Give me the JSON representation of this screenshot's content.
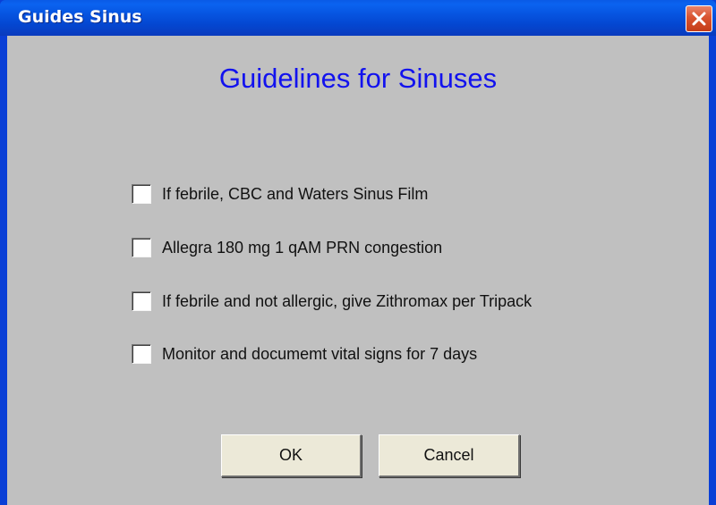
{
  "window": {
    "title": "Guides Sinus",
    "heading": "Guidelines for Sinuses"
  },
  "options": [
    {
      "label": "If febrile, CBC and Waters Sinus Film",
      "checked": false
    },
    {
      "label": "Allegra 180 mg 1 qAM PRN congestion",
      "checked": false
    },
    {
      "label": "If febrile and not allergic, give Zithromax per Tripack",
      "checked": false
    },
    {
      "label": "Monitor and documemt vital signs for 7 days",
      "checked": false
    }
  ],
  "buttons": {
    "ok_label": "OK",
    "cancel_label": "Cancel"
  },
  "colors": {
    "heading": "#1212ee",
    "titlebar": "#0654e0",
    "client": "#c0c0c0",
    "close_button": "#d9532f"
  },
  "icons": {
    "close": "close-icon"
  }
}
